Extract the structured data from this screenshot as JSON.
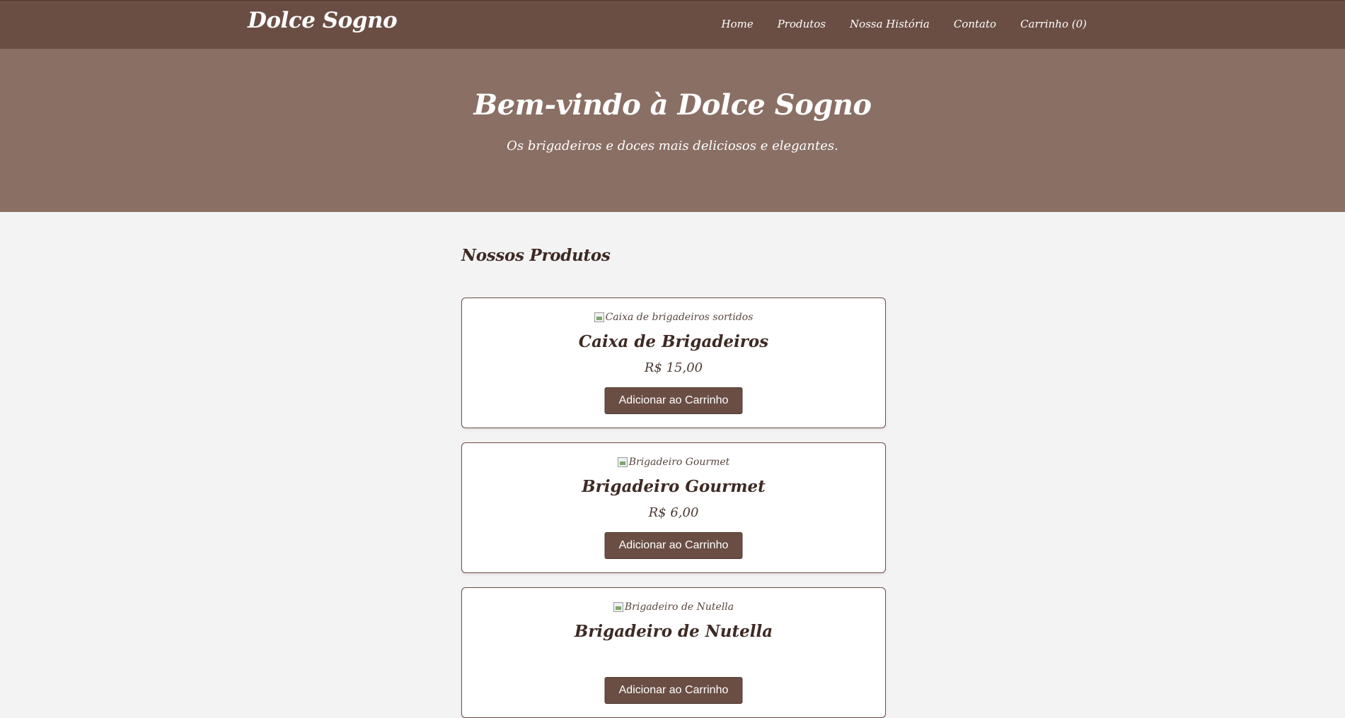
{
  "colors": {
    "header_bg": "#6a4e44",
    "hero_bg": "#8a6f65",
    "page_bg": "#f4f3f3",
    "text_dark": "#3e2a23",
    "button_bg": "#6a4e44"
  },
  "header": {
    "brand": "Dolce Sogno",
    "nav": [
      {
        "label": "Home"
      },
      {
        "label": "Produtos"
      },
      {
        "label": "Nossa História"
      },
      {
        "label": "Contato"
      },
      {
        "label": "Carrinho (0)"
      }
    ]
  },
  "hero": {
    "title": "Bem-vindo à Dolce Sogno",
    "subtitle": "Os brigadeiros e doces mais deliciosos e elegantes."
  },
  "products": {
    "heading": "Nossos Produtos",
    "items": [
      {
        "image_alt": "Caixa de brigadeiros sortidos",
        "name": "Caixa de Brigadeiros",
        "price": "R$ 15,00",
        "button": "Adicionar ao Carrinho"
      },
      {
        "image_alt": "Brigadeiro Gourmet",
        "name": "Brigadeiro Gourmet",
        "price": "R$ 6,00",
        "button": "Adicionar ao Carrinho"
      },
      {
        "image_alt": "Brigadeiro de Nutella",
        "name": "Brigadeiro de Nutella",
        "price": "",
        "button": "Adicionar ao Carrinho"
      }
    ]
  }
}
